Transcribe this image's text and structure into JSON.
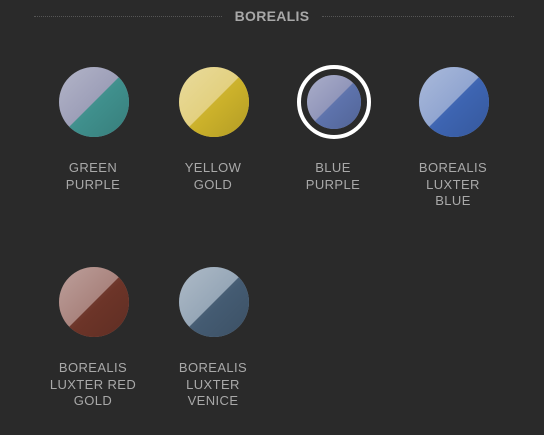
{
  "section": {
    "title": "BOREALIS"
  },
  "swatches": [
    {
      "label": "GREEN\nPURPLE",
      "color_a": "#9a9cb6",
      "color_b": "#3f8f8c",
      "selected": false
    },
    {
      "label": "YELLOW\nGOLD",
      "color_a": "#e2cf7c",
      "color_b": "#cbb12a",
      "selected": false
    },
    {
      "label": "BLUE\nPURPLE",
      "color_a": "#8e93b8",
      "color_b": "#5d72ab",
      "selected": true
    },
    {
      "label": "BOREALIS\nLUXTER\nBLUE",
      "color_a": "#8ea3cf",
      "color_b": "#3d64b1",
      "selected": false
    },
    {
      "label": "BOREALIS\nLUXTER RED\nGOLD",
      "color_a": "#a7807a",
      "color_b": "#6c3428",
      "selected": false
    },
    {
      "label": "BOREALIS\nLUXTER\nVENICE",
      "color_a": "#93a4b5",
      "color_b": "#445b72",
      "selected": false
    }
  ]
}
